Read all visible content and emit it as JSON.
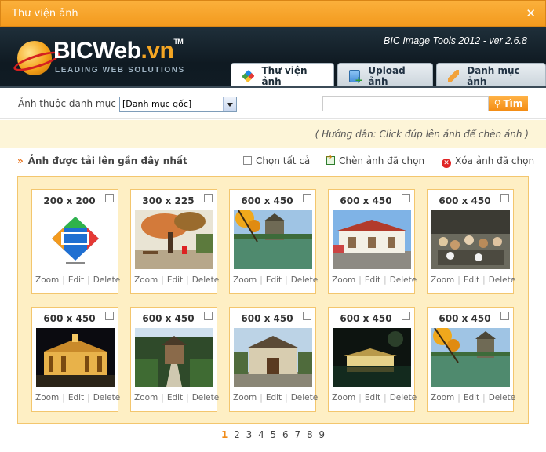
{
  "window": {
    "title": "Thư viện ảnh",
    "close_symbol": "✕"
  },
  "header": {
    "logo_name": "BICWeb",
    "logo_suffix": ".vn",
    "logo_tm": "TM",
    "logo_tagline": "LEADING WEB SOLUTIONS",
    "version": "BIC Image Tools 2012 - ver 2.6.8"
  },
  "tabs": [
    {
      "label": "Thư viện ảnh",
      "icon": "gallery-icon",
      "active": true
    },
    {
      "label": "Upload ảnh",
      "icon": "upload-icon",
      "active": false
    },
    {
      "label": "Danh mục ảnh",
      "icon": "category-icon",
      "active": false
    }
  ],
  "filter": {
    "category_label": "Ảnh thuộc danh mục",
    "category_value": "[Danh mục gốc]",
    "search_value": "",
    "search_button": "Tìm"
  },
  "hint": "( Hướng dẫn: Click đúp lên ảnh để chèn ảnh )",
  "actions": {
    "recent_label": "Ảnh được tải lên gần đây nhất",
    "select_all": "Chọn tất cả",
    "insert_selected": "Chèn ảnh đã chọn",
    "delete_selected": "Xóa ảnh đã chọn"
  },
  "card_ops": {
    "zoom": "Zoom",
    "edit": "Edit",
    "delete": "Delete"
  },
  "images": [
    {
      "size": "200 x 200",
      "thumb": "bic-logo"
    },
    {
      "size": "300 x 225",
      "thumb": "tree-park"
    },
    {
      "size": "600 x 450",
      "thumb": "lake-tower"
    },
    {
      "size": "600 x 450",
      "thumb": "market-building"
    },
    {
      "size": "600 x 450",
      "thumb": "crowd-street"
    },
    {
      "size": "600 x 450",
      "thumb": "opera-night"
    },
    {
      "size": "600 x 450",
      "thumb": "temple-path"
    },
    {
      "size": "600 x 450",
      "thumb": "temple-gate"
    },
    {
      "size": "600 x 450",
      "thumb": "lake-night"
    },
    {
      "size": "600 x 450",
      "thumb": "lake-tower-2"
    }
  ],
  "pagination": {
    "pages": [
      "1",
      "2",
      "3",
      "4",
      "5",
      "6",
      "7",
      "8",
      "9"
    ],
    "current": "1"
  },
  "colors": {
    "accent": "#f39a1e",
    "header_bg": "#142029",
    "gallery_bg": "#feefc4",
    "card_border": "#f3c66e"
  }
}
